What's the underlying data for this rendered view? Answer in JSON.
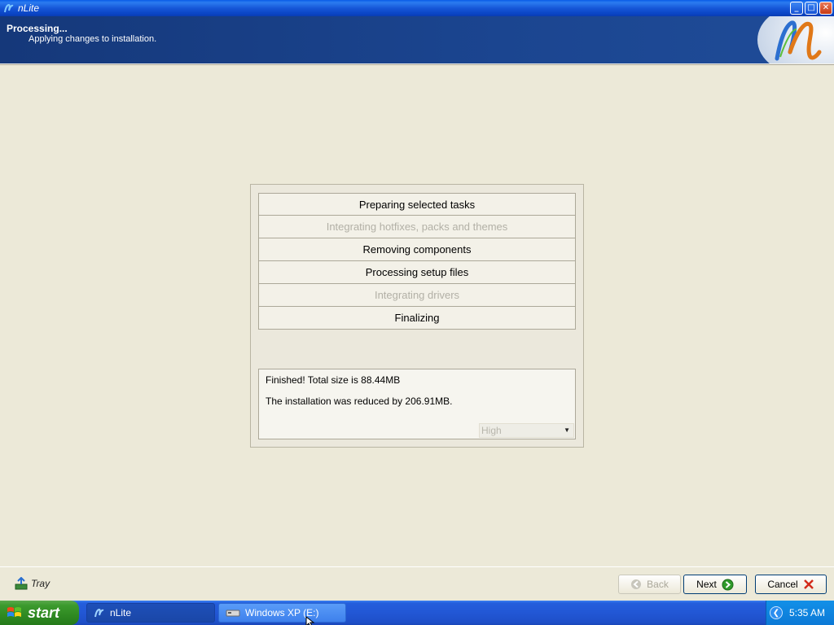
{
  "window": {
    "title": "nLite"
  },
  "header": {
    "title": "Processing...",
    "subtitle": "Applying changes to installation."
  },
  "tasks": [
    {
      "label": "Preparing selected tasks",
      "state": "active"
    },
    {
      "label": "Integrating hotfixes, packs and themes",
      "state": "disabled"
    },
    {
      "label": "Removing components",
      "state": "active"
    },
    {
      "label": "Processing setup files",
      "state": "active"
    },
    {
      "label": "Integrating drivers",
      "state": "disabled"
    },
    {
      "label": "Finalizing",
      "state": "active"
    }
  ],
  "result": {
    "line1": "Finished! Total size is 88.44MB",
    "line2": "The installation was reduced by 206.91MB.",
    "priority": "High"
  },
  "footer": {
    "tray_label": "Tray",
    "back_label": "Back",
    "next_label": "Next",
    "cancel_label": "Cancel"
  },
  "taskbar": {
    "start_label": "start",
    "items": [
      "nLite",
      "Windows XP (E:)"
    ],
    "clock": "5:35 AM"
  },
  "colors": {
    "header_bg": "#1b4590",
    "window_bg": "#ece9d8",
    "disabled_text": "#b2b0a6",
    "taskbar": "#245edc",
    "start": "#3c9a2e"
  }
}
